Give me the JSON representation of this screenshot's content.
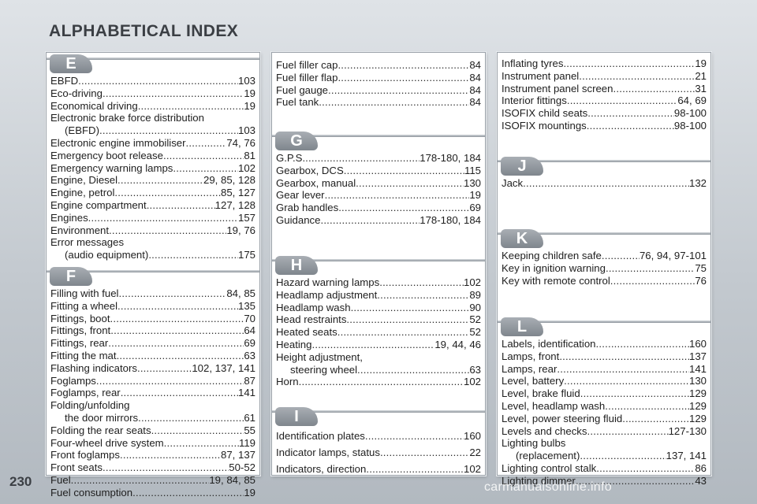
{
  "page": {
    "title": "ALPHABETICAL INDEX",
    "page_number": "230",
    "watermark": "carmanualsonline.info"
  },
  "columns": [
    {
      "sections": [
        {
          "letter": "E",
          "entries": [
            {
              "text": "EBFD",
              "page": "103"
            },
            {
              "text": "Eco-driving",
              "page": "19"
            },
            {
              "text": "Economical driving",
              "page": "19"
            },
            {
              "text": "Electronic brake force distribution",
              "page": ""
            },
            {
              "text": "(EBFD)",
              "page": "103",
              "continuation": true
            },
            {
              "text": "Electronic engine immobiliser",
              "page": "74, 76"
            },
            {
              "text": "Emergency boot release",
              "page": "81"
            },
            {
              "text": "Emergency warning lamps",
              "page": "102"
            },
            {
              "text": "Engine, Diesel",
              "page": "29, 85, 128"
            },
            {
              "text": "Engine, petrol",
              "page": "85, 127"
            },
            {
              "text": "Engine compartment",
              "page": "127, 128"
            },
            {
              "text": "Engines",
              "page": "157"
            },
            {
              "text": "Environment",
              "page": "19, 76"
            },
            {
              "text": "Error messages",
              "page": ""
            },
            {
              "text": "(audio equipment)",
              "page": "175",
              "continuation": true
            }
          ]
        },
        {
          "letter": "F",
          "entries": [
            {
              "text": "Filling with fuel",
              "page": "84, 85"
            },
            {
              "text": "Fitting a wheel",
              "page": "135"
            },
            {
              "text": "Fittings, boot",
              "page": "70"
            },
            {
              "text": "Fittings, front",
              "page": "64"
            },
            {
              "text": "Fittings, rear",
              "page": "69"
            },
            {
              "text": "Fitting the mat",
              "page": "63"
            },
            {
              "text": "Flashing indicators",
              "page": "102, 137, 141"
            },
            {
              "text": "Foglamps",
              "page": "87"
            },
            {
              "text": "Foglamps, rear",
              "page": "141"
            },
            {
              "text": "Folding/unfolding",
              "page": ""
            },
            {
              "text": "the door mirrors",
              "page": "61",
              "continuation": true
            },
            {
              "text": "Folding the rear seats",
              "page": "55"
            },
            {
              "text": "Four-wheel drive system",
              "page": "119"
            },
            {
              "text": "Front foglamps",
              "page": "87, 137"
            },
            {
              "text": "Front seats",
              "page": "50-52"
            },
            {
              "text": "Fuel",
              "page": "19, 84, 85"
            },
            {
              "text": "Fuel consumption",
              "page": "19"
            }
          ]
        }
      ]
    },
    {
      "sections": [
        {
          "letter": "",
          "entries": [
            {
              "text": "Fuel filler cap",
              "page": "84"
            },
            {
              "text": "Fuel filler flap",
              "page": "84"
            },
            {
              "text": "Fuel gauge",
              "page": "84"
            },
            {
              "text": "Fuel tank",
              "page": "84"
            }
          ]
        },
        {
          "letter": "G",
          "entries": [
            {
              "text": "G.P.S.",
              "page": "178-180, 184"
            },
            {
              "text": "Gearbox, DCS",
              "page": "115"
            },
            {
              "text": "Gearbox, manual",
              "page": "130"
            },
            {
              "text": "Gear lever",
              "page": "19"
            },
            {
              "text": "Grab handles",
              "page": "69"
            },
            {
              "text": "Guidance",
              "page": "178-180, 184"
            }
          ]
        },
        {
          "letter": "H",
          "entries": [
            {
              "text": "Hazard warning lamps",
              "page": "102"
            },
            {
              "text": "Headlamp adjustment",
              "page": "89"
            },
            {
              "text": "Headlamp wash",
              "page": "90"
            },
            {
              "text": "Head restraints",
              "page": "52"
            },
            {
              "text": "Heated seats",
              "page": "52"
            },
            {
              "text": "Heating",
              "page": "19, 44, 46"
            },
            {
              "text": "Height adjustment,",
              "page": ""
            },
            {
              "text": "steering wheel",
              "page": "63",
              "continuation": true
            },
            {
              "text": "Horn",
              "page": "102"
            }
          ]
        },
        {
          "letter": "I",
          "entries": [
            {
              "text": "Identification plates",
              "page": "160"
            },
            {
              "text": "Indicator lamps, status",
              "page": "22"
            },
            {
              "text": "Indicators, direction",
              "page": "102"
            }
          ]
        }
      ]
    },
    {
      "sections": [
        {
          "letter": "",
          "entries": [
            {
              "text": "Inflating tyres",
              "page": "19"
            },
            {
              "text": "Instrument panel",
              "page": "21"
            },
            {
              "text": "Instrument panel screen",
              "page": "31"
            },
            {
              "text": "Interior fittings",
              "page": "64, 69"
            },
            {
              "text": "ISOFIX child seats",
              "page": "98-100"
            },
            {
              "text": "ISOFIX mountings",
              "page": "98-100"
            }
          ]
        },
        {
          "letter": "J",
          "entries": [
            {
              "text": "Jack",
              "page": "132"
            }
          ]
        },
        {
          "letter": "K",
          "entries": [
            {
              "text": "Keeping children safe",
              "page": "76, 94, 97-101"
            },
            {
              "text": "Key in ignition warning",
              "page": "75"
            },
            {
              "text": "Key with remote control",
              "page": "76"
            }
          ]
        },
        {
          "letter": "L",
          "entries": [
            {
              "text": "Labels, identification",
              "page": "160"
            },
            {
              "text": "Lamps, front",
              "page": "137"
            },
            {
              "text": "Lamps, rear",
              "page": "141"
            },
            {
              "text": "Level, battery",
              "page": "130"
            },
            {
              "text": "Level, brake fluid",
              "page": "129"
            },
            {
              "text": "Level, headlamp wash",
              "page": "129"
            },
            {
              "text": "Level, power steering fluid",
              "page": "129"
            },
            {
              "text": "Levels and checks",
              "page": "127-130"
            },
            {
              "text": "Lighting bulbs",
              "page": ""
            },
            {
              "text": "(replacement)",
              "page": "137, 141",
              "continuation": true
            },
            {
              "text": "Lighting control stalk",
              "page": "86"
            },
            {
              "text": "Lighting dimmer",
              "page": "43"
            }
          ]
        }
      ]
    }
  ]
}
